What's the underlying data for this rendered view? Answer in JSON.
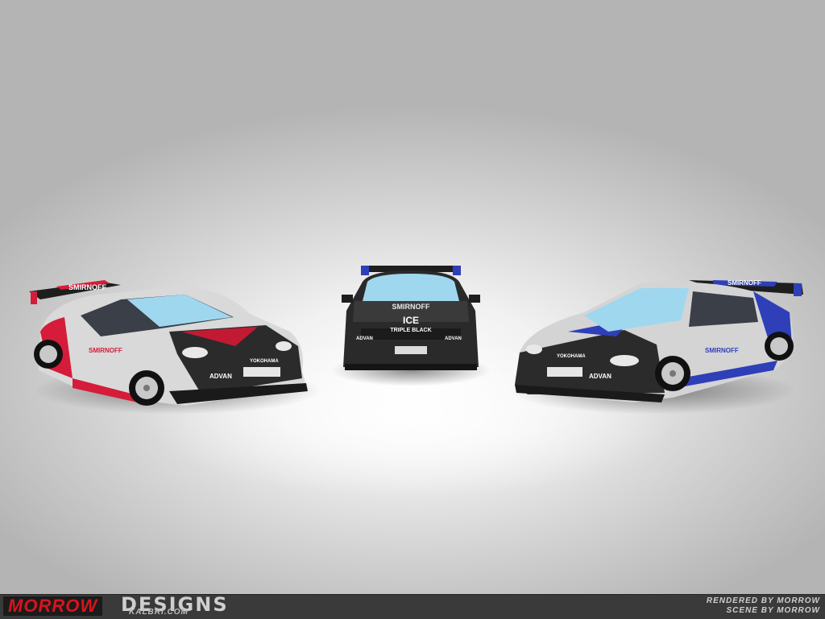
{
  "cars": {
    "left": {
      "livery_color": "#d51c3a",
      "sponsor": "SMIRNOFF",
      "tyre": "ADVAN",
      "brand2": "YOKOHAMA"
    },
    "center": {
      "livery_color": "#2a2a2a",
      "top_text": "SMIRNOFF",
      "headline": "ICE",
      "subline": "TRIPLE BLACK",
      "tyre": "ADVAN"
    },
    "right": {
      "livery_color": "#2f3fb8",
      "sponsor": "SMIRNOFF",
      "tyre": "ADVAN",
      "brand2": "YOKOHAMA"
    }
  },
  "footer": {
    "brand_part1": "MORROW",
    "brand_part2": "DESIGNS",
    "url": "KALBRI.COM",
    "credit_line1": "RENDERED BY MORROW",
    "credit_line2": "SCENE BY MORROW"
  }
}
